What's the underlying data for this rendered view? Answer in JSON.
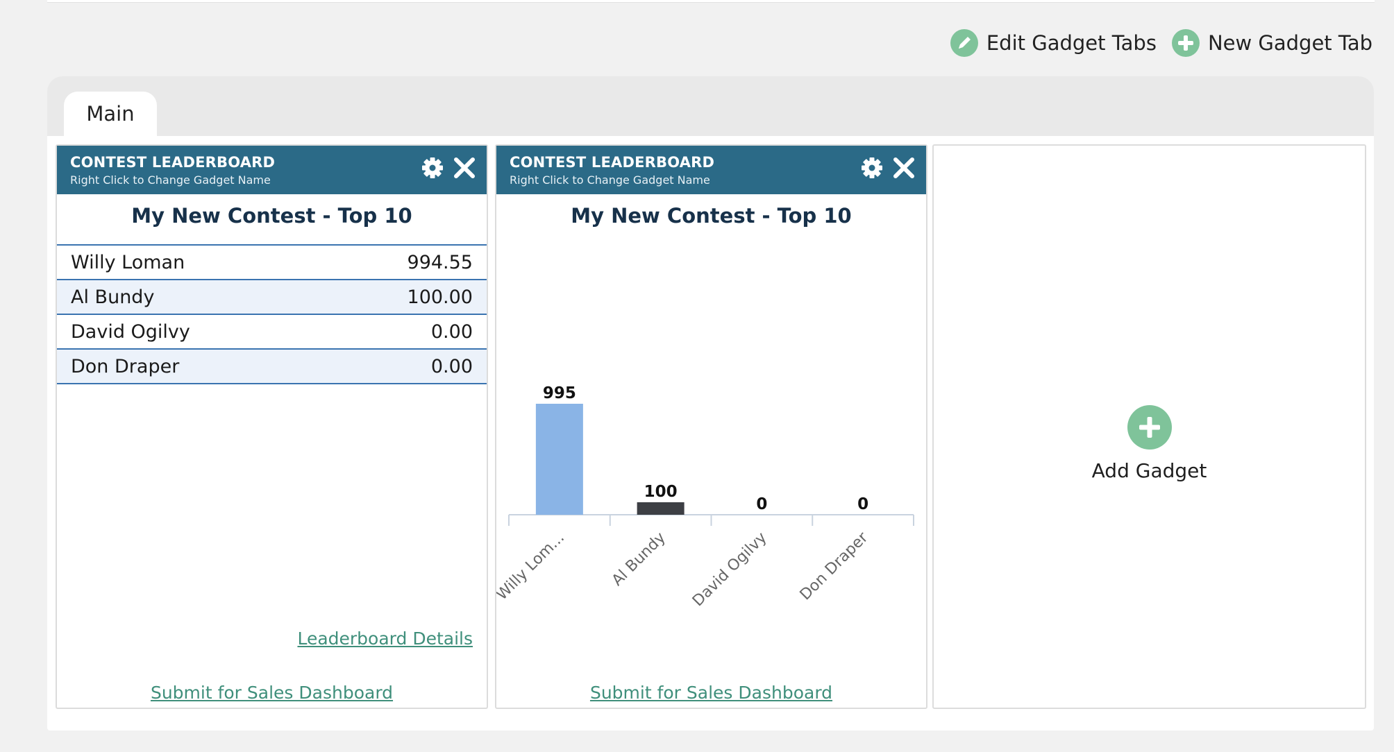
{
  "top_actions": {
    "edit_label": "Edit Gadget Tabs",
    "edit_icon": "pencil-icon",
    "new_label": "New Gadget Tab",
    "new_icon": "plus-icon",
    "icon_color": "#7fc39a"
  },
  "tabs": [
    {
      "label": "Main",
      "active": true
    }
  ],
  "gadgets": [
    {
      "title": "CONTEST LEADERBOARD",
      "subtitle": "Right Click to Change Gadget Name",
      "contest_title": "My New Contest - Top 10",
      "rows": [
        {
          "name": "Willy Loman",
          "value": "994.55"
        },
        {
          "name": "Al Bundy",
          "value": "100.00"
        },
        {
          "name": "David Ogilvy",
          "value": "0.00"
        },
        {
          "name": "Don Draper",
          "value": "0.00"
        }
      ],
      "details_link": "Leaderboard Details",
      "submit_link": "Submit for Sales Dashboard"
    },
    {
      "title": "CONTEST LEADERBOARD",
      "subtitle": "Right Click to Change Gadget Name",
      "contest_title": "My New Contest - Top 10",
      "submit_link": "Submit for Sales Dashboard"
    }
  ],
  "chart_data": {
    "type": "bar",
    "categories": [
      "Willy Lom...",
      "Al Bundy",
      "David Ogilvy",
      "Don Draper"
    ],
    "values": [
      995,
      100,
      0,
      0
    ],
    "data_labels": [
      "995",
      "100",
      "0",
      "0"
    ],
    "bar_colors": [
      "#8ab4e6",
      "#3d3f44",
      "#3d3f44",
      "#3d3f44"
    ],
    "title": "",
    "xlabel": "",
    "ylabel": "",
    "ylim": [
      0,
      995
    ],
    "grid": false,
    "legend": "none"
  },
  "add_gadget": {
    "label": "Add Gadget"
  },
  "colors": {
    "header": "#2b6a87",
    "row_border": "#3a73b0",
    "row_alt": "#ecf2fa",
    "link": "#3f8f7b",
    "accent": "#7fc39a"
  }
}
